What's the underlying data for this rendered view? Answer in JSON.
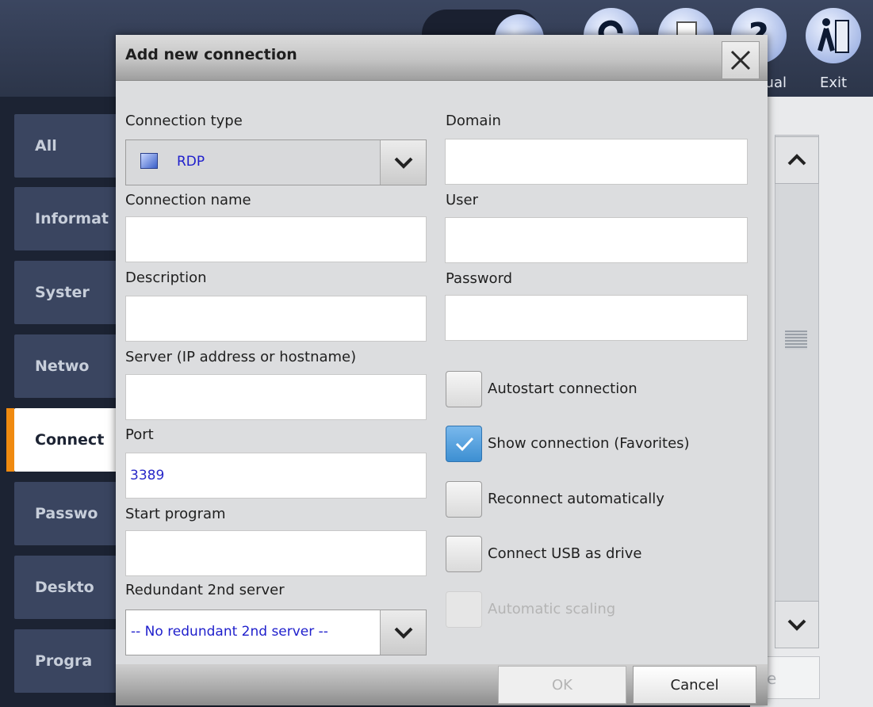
{
  "toolbar": {
    "manual_label": "Manual",
    "manual_visible_label": "ual",
    "exit_label": "Exit"
  },
  "sidebar": {
    "items": [
      {
        "label": "All",
        "active": false
      },
      {
        "label": "Informat",
        "active": false
      },
      {
        "label": "Syster",
        "active": false
      },
      {
        "label": "Netwo",
        "active": false
      },
      {
        "label": "Connect",
        "active": true
      },
      {
        "label": "Passwo",
        "active": false
      },
      {
        "label": "Deskto",
        "active": false
      },
      {
        "label": "Progra",
        "active": false
      }
    ]
  },
  "background": {
    "footer_button_partial": "e"
  },
  "dialog": {
    "title": "Add new connection",
    "left": {
      "connection_type": {
        "label": "Connection type",
        "value": "RDP",
        "icon": "rdp-icon"
      },
      "connection_name": {
        "label": "Connection name",
        "value": ""
      },
      "description": {
        "label": "Description",
        "value": ""
      },
      "server": {
        "label": "Server (IP address or hostname)",
        "value": ""
      },
      "port": {
        "label": "Port",
        "value": "3389"
      },
      "start_program": {
        "label": "Start program",
        "value": ""
      },
      "redundant": {
        "label": "Redundant 2nd server",
        "value": "-- No redundant 2nd server --"
      }
    },
    "right": {
      "domain": {
        "label": "Domain",
        "value": ""
      },
      "user": {
        "label": "User",
        "value": ""
      },
      "password": {
        "label": "Password",
        "value": ""
      },
      "checkboxes": [
        {
          "label": "Autostart connection",
          "checked": false,
          "enabled": true
        },
        {
          "label": "Show connection (Favorites)",
          "checked": true,
          "enabled": true
        },
        {
          "label": "Reconnect automatically",
          "checked": false,
          "enabled": true
        },
        {
          "label": "Connect USB as drive",
          "checked": false,
          "enabled": true
        },
        {
          "label": "Automatic scaling",
          "checked": false,
          "enabled": false
        }
      ]
    },
    "buttons": {
      "ok": "OK",
      "cancel": "Cancel"
    }
  },
  "colors": {
    "accent_orange": "#f08a10",
    "value_blue": "#2828c8",
    "checkbox_checked": "#3d8fd2"
  }
}
